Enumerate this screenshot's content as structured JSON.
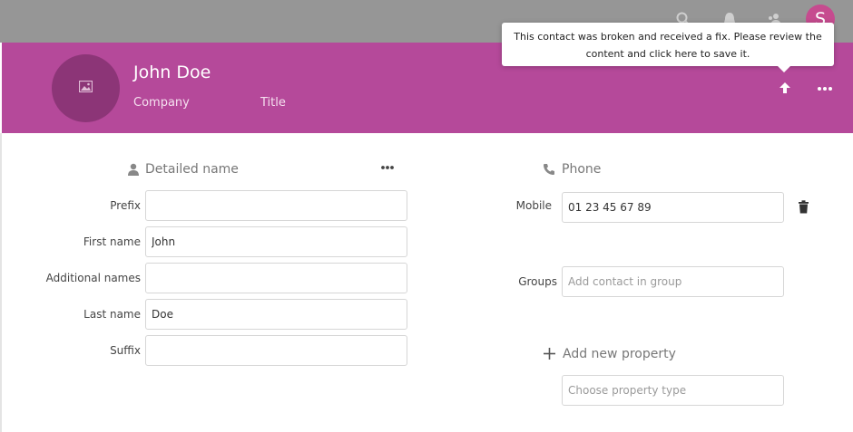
{
  "header": {
    "name": "John Doe",
    "company": "Company",
    "title": "Title",
    "user_initial": "S",
    "accent": "#b5499a"
  },
  "tooltip": {
    "text": "This contact was broken and received a fix. Please review the content and click here to save it."
  },
  "detailed_name": {
    "title": "Detailed name",
    "fields": [
      {
        "label": "Prefix",
        "value": ""
      },
      {
        "label": "First name",
        "value": "John"
      },
      {
        "label": "Additional names",
        "value": ""
      },
      {
        "label": "Last name",
        "value": "Doe"
      },
      {
        "label": "Suffix",
        "value": ""
      }
    ]
  },
  "phone": {
    "title": "Phone",
    "label": "Mobile",
    "value": "01 23 45 67 89"
  },
  "groups": {
    "label": "Groups",
    "placeholder": "Add contact in group"
  },
  "add_property": {
    "label": "Add new property",
    "placeholder": "Choose property type"
  },
  "icons": [
    "search-icon",
    "bell-icon",
    "contacts-icon",
    "image-icon",
    "upload-arrow-icon",
    "more-icon",
    "person-icon",
    "phone-icon",
    "trash-icon",
    "plus-icon"
  ]
}
